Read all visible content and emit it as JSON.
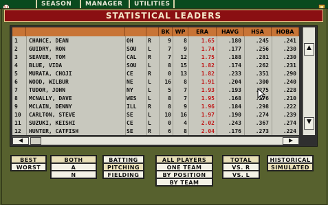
{
  "menu": {
    "items": [
      "SEASON",
      "MANAGER",
      "UTILITIES"
    ]
  },
  "title": "STATISTICAL LEADERS",
  "table": {
    "columns": [
      "",
      "",
      "",
      "",
      "BK",
      "WP",
      "ERA",
      "HAVG",
      "HSA",
      "HOBA"
    ],
    "rows": [
      {
        "rank": "1",
        "name": "CHANCE, DEAN",
        "team": "OH",
        "hand": "R",
        "bk": "9",
        "wp": "8",
        "era": "1.65",
        "havg": ".180",
        "hsa": ".245",
        "hoba": ".241"
      },
      {
        "rank": "2",
        "name": "GUIDRY, RON",
        "team": "SOU",
        "hand": "L",
        "bk": "7",
        "wp": "9",
        "era": "1.74",
        "havg": ".177",
        "hsa": ".256",
        "hoba": ".230"
      },
      {
        "rank": "3",
        "name": "SEAVER, TOM",
        "team": "CAL",
        "hand": "R",
        "bk": "7",
        "wp": "12",
        "era": "1.75",
        "havg": ".188",
        "hsa": ".281",
        "hoba": ".230"
      },
      {
        "rank": "4",
        "name": "BLUE, VIDA",
        "team": "SOU",
        "hand": "L",
        "bk": "8",
        "wp": "15",
        "era": "1.82",
        "havg": ".174",
        "hsa": ".262",
        "hoba": ".231"
      },
      {
        "rank": "5",
        "name": "MURATA, CHOJI",
        "team": "CE",
        "hand": "R",
        "bk": "0",
        "wp": "13",
        "era": "1.82",
        "havg": ".233",
        "hsa": ".351",
        "hoba": ".290"
      },
      {
        "rank": "6",
        "name": "WOOD, WILBUR",
        "team": "NE",
        "hand": "L",
        "bk": "16",
        "wp": "8",
        "era": "1.91",
        "havg": ".204",
        "hsa": ".300",
        "hoba": ".240"
      },
      {
        "rank": "7",
        "name": "TUDOR, JOHN",
        "team": "NY",
        "hand": "L",
        "bk": "5",
        "wp": "7",
        "era": "1.93",
        "havg": ".193",
        "hsa": ".275",
        "hoba": ".228"
      },
      {
        "rank": "8",
        "name": "MCNALLY, DAVE",
        "team": "WES",
        "hand": "L",
        "bk": "8",
        "wp": "7",
        "era": "1.95",
        "havg": ".168",
        "hsa": ".276",
        "hoba": ".210"
      },
      {
        "rank": "9",
        "name": "MCLAIN, DENNY",
        "team": "ILL",
        "hand": "R",
        "bk": "8",
        "wp": "9",
        "era": "1.96",
        "havg": ".184",
        "hsa": ".298",
        "hoba": ".222"
      },
      {
        "rank": "10",
        "name": "CARLTON, STEVE",
        "team": "SE",
        "hand": "L",
        "bk": "10",
        "wp": "16",
        "era": "1.97",
        "havg": ".190",
        "hsa": ".274",
        "hoba": ".239"
      },
      {
        "rank": "11",
        "name": "SUZUKI, KEISHI",
        "team": "CE",
        "hand": "L",
        "bk": "0",
        "wp": "4",
        "era": "2.02",
        "havg": ".243",
        "hsa": ".367",
        "hoba": ".274"
      },
      {
        "rank": "12",
        "name": "HUNTER, CATFISH",
        "team": "SE",
        "hand": "R",
        "bk": "6",
        "wp": "8",
        "era": "2.04",
        "havg": ".176",
        "hsa": ".273",
        "hoba": ".224"
      }
    ]
  },
  "options": {
    "best": "BEST",
    "worst": "WORST",
    "both": "BOTH",
    "a": "A",
    "n": "N",
    "batting": "BATTING",
    "pitching": "PITCHING",
    "fielding": "FIELDING",
    "all_players": "ALL PLAYERS",
    "one_team": "ONE TEAM",
    "by_position": "BY POSITION",
    "by_team": "BY TEAM",
    "total": "TOTAL",
    "vs_r": "VS. R",
    "vs_l": "VS. L",
    "historical": "HISTORICAL",
    "simulated": "SIMULATED"
  },
  "colors": {
    "title_bg": "#8a0f12",
    "header_bg": "#c87436",
    "era_text": "#c01818",
    "panel_bg": "#57612e",
    "topbar_bg": "#0a4a1e"
  }
}
